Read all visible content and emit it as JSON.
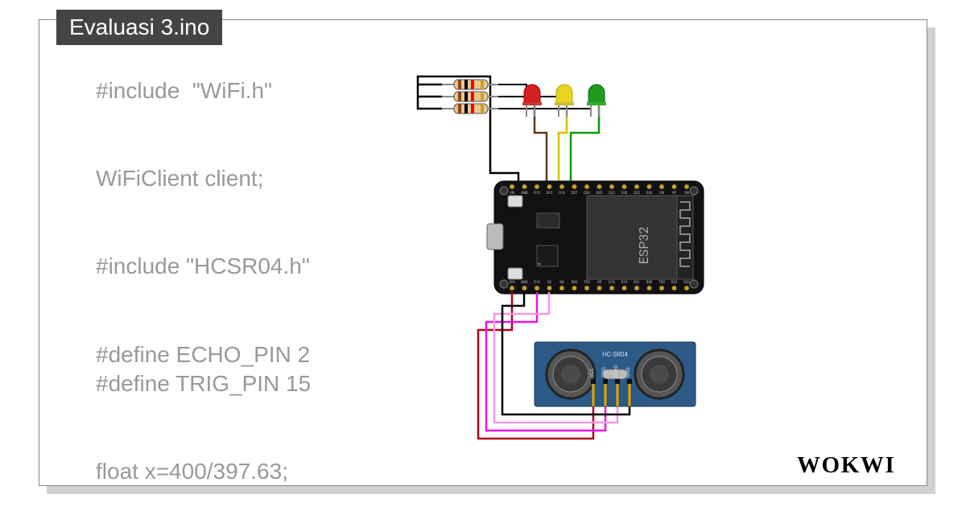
{
  "tab_title": "Evaluasi 3.ino",
  "code_lines": [
    "#include  \"WiFi.h\"",
    "",
    "",
    "WiFiClient client;",
    "",
    "",
    "#include \"HCSR04.h\"",
    "",
    "",
    "#define ECHO_PIN 2",
    "#define TRIG_PIN 15",
    "",
    "",
    "float x=400/397.63;"
  ],
  "brand": "WOKWI",
  "components": {
    "board": {
      "name": "ESP32",
      "top_pins": [
        "VN",
        "GND",
        "D13",
        "D12",
        "D14",
        "D27",
        "D26",
        "D25",
        "D33",
        "D32",
        "D35",
        "D34",
        "VN",
        "VP",
        "EN"
      ],
      "bottom_pins_partial": [
        "3V3",
        "GND",
        "D15",
        "D2",
        "D4",
        "RX2",
        "TX2",
        "D5",
        "D18",
        "D19",
        "D21",
        "RX0",
        "TX0",
        "D22",
        "D23"
      ]
    },
    "leds": [
      {
        "color": "red",
        "wire": "#000000"
      },
      {
        "color": "yellow",
        "wire": "#bfa000"
      },
      {
        "color": "green",
        "wire": "#00aa00"
      }
    ],
    "resistors": 3,
    "ultrasonic": {
      "label": "HC-SR04",
      "pins": [
        "VCC",
        "TRIG",
        "ECHO",
        "GND"
      ]
    },
    "wires": [
      {
        "from": "resistors",
        "to": "esp32-gnd-top",
        "color": "#000000"
      },
      {
        "from": "led-red",
        "to": "esp32-top",
        "color": "#5a3a1a"
      },
      {
        "from": "led-yellow",
        "to": "esp32-top",
        "color": "#d4c400"
      },
      {
        "from": "led-green",
        "to": "esp32-top",
        "color": "#0b9b0b"
      },
      {
        "from": "hcsr04-vcc",
        "to": "esp32-3v3",
        "color": "#b00020"
      },
      {
        "from": "hcsr04-trig",
        "to": "esp32-d15",
        "color": "#d400d4"
      },
      {
        "from": "hcsr04-echo",
        "to": "esp32-d2",
        "color": "#e97bd4"
      },
      {
        "from": "hcsr04-gnd",
        "to": "esp32-gnd-bottom",
        "color": "#000000"
      }
    ]
  }
}
